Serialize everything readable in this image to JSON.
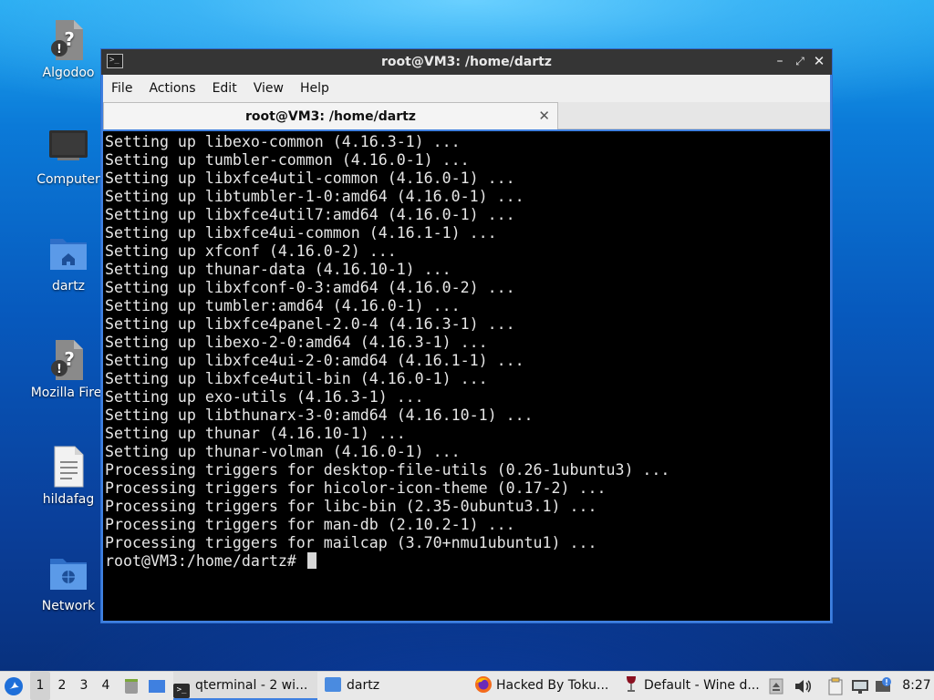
{
  "desktop": {
    "icons": [
      {
        "label": "Algodoo",
        "icon": "unknown-file-icon"
      },
      {
        "label": "Computer",
        "icon": "monitor-icon"
      },
      {
        "label": "dartz",
        "icon": "home-folder-icon"
      },
      {
        "label": "Mozilla Firef",
        "icon": "unknown-file-icon"
      },
      {
        "label": "hildafag",
        "icon": "text-file-icon"
      },
      {
        "label": "Network",
        "icon": "network-folder-icon"
      }
    ]
  },
  "window": {
    "title": "root@VM3: /home/dartz",
    "controls": {
      "minimize": "–",
      "maximize": "⤢",
      "close": "✕"
    },
    "menu": [
      "File",
      "Actions",
      "Edit",
      "View",
      "Help"
    ],
    "tab": {
      "label": "root@VM3: /home/dartz",
      "close": "✕"
    },
    "terminal": {
      "lines": [
        "Setting up libexo-common (4.16.3-1) ...",
        "Setting up tumbler-common (4.16.0-1) ...",
        "Setting up libxfce4util-common (4.16.0-1) ...",
        "Setting up libtumbler-1-0:amd64 (4.16.0-1) ...",
        "Setting up libxfce4util7:amd64 (4.16.0-1) ...",
        "Setting up libxfce4ui-common (4.16.1-1) ...",
        "Setting up xfconf (4.16.0-2) ...",
        "Setting up thunar-data (4.16.10-1) ...",
        "Setting up libxfconf-0-3:amd64 (4.16.0-2) ...",
        "Setting up tumbler:amd64 (4.16.0-1) ...",
        "Setting up libxfce4panel-2.0-4 (4.16.3-1) ...",
        "Setting up libexo-2-0:amd64 (4.16.3-1) ...",
        "Setting up libxfce4ui-2-0:amd64 (4.16.1-1) ...",
        "Setting up libxfce4util-bin (4.16.0-1) ...",
        "Setting up exo-utils (4.16.3-1) ...",
        "Setting up libthunarx-3-0:amd64 (4.16.10-1) ...",
        "Setting up thunar (4.16.10-1) ...",
        "Setting up thunar-volman (4.16.0-1) ...",
        "Processing triggers for desktop-file-utils (0.26-1ubuntu3) ...",
        "Processing triggers for hicolor-icon-theme (0.17-2) ...",
        "Processing triggers for libc-bin (2.35-0ubuntu3.1) ...",
        "Processing triggers for man-db (2.10.2-1) ...",
        "Processing triggers for mailcap (3.70+nmu1ubuntu1) ..."
      ],
      "prompt": "root@VM3:/home/dartz# "
    }
  },
  "taskbar": {
    "workspaces": [
      "1",
      "2",
      "3",
      "4"
    ],
    "active_workspace": "1",
    "tasks": [
      {
        "label": "qterminal - 2 wi...",
        "icon": "terminal-icon",
        "active": true
      },
      {
        "label": "dartz",
        "icon": "folder-icon",
        "active": false
      },
      {
        "label": "Hacked By Toku...",
        "icon": "firefox-icon",
        "active": false
      },
      {
        "label": "Default - Wine d...",
        "icon": "wine-icon",
        "active": false
      }
    ],
    "clock": "8:27"
  },
  "colors": {
    "accent": "#3f80e0",
    "terminal_bg": "#000000",
    "terminal_fg": "#e6e6e6",
    "titlebar": "#353535"
  }
}
